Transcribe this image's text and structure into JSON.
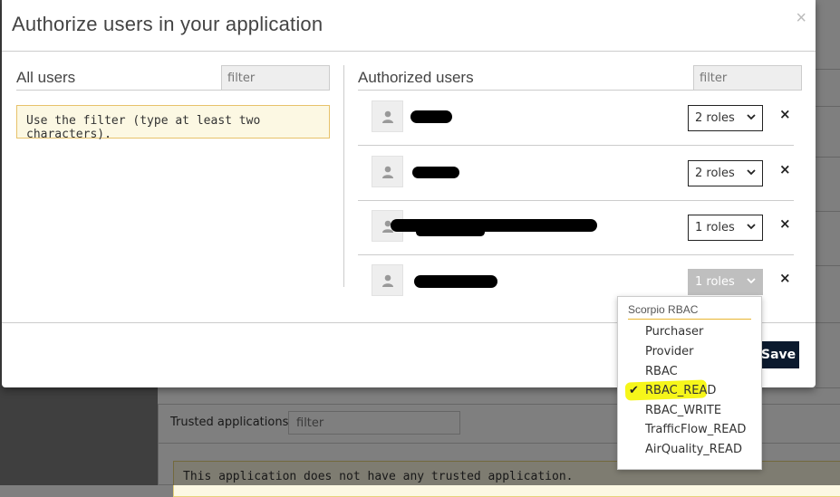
{
  "modal": {
    "title": "Authorize users in your application",
    "close_symbol": "×",
    "save_label": "Save"
  },
  "all_users": {
    "title": "All users",
    "filter_placeholder": "filter",
    "alert": "Use the filter (type at least two characters)."
  },
  "authorized_users": {
    "title": "Authorized users",
    "filter_placeholder": "filter",
    "rows": [
      {
        "roles_label": "2 roles",
        "remove_symbol": "×"
      },
      {
        "roles_label": "2 roles",
        "remove_symbol": "×"
      },
      {
        "roles_label": "1 roles",
        "remove_symbol": "×"
      },
      {
        "roles_label": "1 roles",
        "remove_symbol": "×",
        "open": true
      }
    ]
  },
  "roles_dropdown": {
    "group": "Scorpio RBAC",
    "items": [
      {
        "label": "Purchaser",
        "checked": false
      },
      {
        "label": "Provider",
        "checked": false
      },
      {
        "label": "RBAC",
        "checked": false
      },
      {
        "label": "RBAC_READ",
        "checked": true,
        "highlighted": true
      },
      {
        "label": "RBAC_WRITE",
        "checked": false
      },
      {
        "label": "TrafficFlow_READ",
        "checked": false
      },
      {
        "label": "AirQuality_READ",
        "checked": false
      }
    ],
    "check_symbol": "✔",
    "highlight_color": "#f6f61a"
  },
  "background": {
    "trusted_label": "Trusted applications",
    "trusted_filter_placeholder": "filter",
    "trusted_message": "This application does not have any trusted application."
  },
  "colors": {
    "save_button": "#0b1a2e",
    "alert_bg": "#fcf8e3",
    "dropdown_group_line": "#e8b530"
  },
  "icons": {
    "avatar": "user-icon",
    "select": "chevron-down-icon",
    "close": "close-icon"
  }
}
